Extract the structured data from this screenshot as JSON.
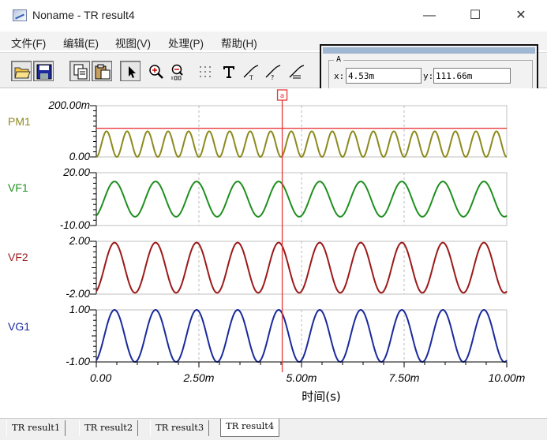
{
  "window": {
    "title": "Noname - TR result4",
    "minimize_glyph": "—",
    "maximize_glyph": "☐",
    "close_glyph": "✕"
  },
  "menu": [
    {
      "label": "文件(F)"
    },
    {
      "label": "编辑(E)"
    },
    {
      "label": "视图(V)"
    },
    {
      "label": "处理(P)"
    },
    {
      "label": "帮助(H)"
    }
  ],
  "toolbar": {
    "icons": [
      "open-folder-icon",
      "save-icon",
      "copy-icon",
      "paste-icon",
      "pointer-icon",
      "zoom-in-icon",
      "zoom-100-icon",
      "grid-icon",
      "text-icon",
      "curve-tool-1-icon",
      "curve-tool-2-icon",
      "curve-tool-3-icon"
    ]
  },
  "cursor_readout": {
    "label": "A",
    "x_label": "x:",
    "x_value": "4.53m",
    "y_label": "y:",
    "y_value": "111.66m"
  },
  "cursor": {
    "label": "a",
    "time": 0.00453,
    "color": "#e8393a"
  },
  "chart_data": {
    "type": "line",
    "xlabel": "时间(s)",
    "xlim": [
      0,
      0.01
    ],
    "x_tick_labels": [
      "0.00",
      "2.50m",
      "5.00m",
      "7.50m",
      "10.00m"
    ],
    "x_ticks": [
      0,
      0.0025,
      0.005,
      0.0075,
      0.01
    ],
    "series": [
      {
        "name": "PM1",
        "color": "#8c8a1e",
        "ylim": [
          0,
          0.2
        ],
        "y_tick_labels": [
          "200.00m",
          "0.00"
        ],
        "offset": 0.05,
        "amplitude": 0.05,
        "periods": 20,
        "reference_line": 0.1117,
        "reference_color": "#e8393a"
      },
      {
        "name": "VF1",
        "color": "#1f8f1f",
        "ylim": [
          -10,
          20
        ],
        "y_tick_labels": [
          "20.00",
          "-10.00"
        ],
        "offset": 5,
        "amplitude": 10,
        "periods": 10
      },
      {
        "name": "VF2",
        "color": "#9b1a1a",
        "ylim": [
          -2,
          2
        ],
        "y_tick_labels": [
          "2.00",
          "-2.00"
        ],
        "offset": 0,
        "amplitude": 1.9,
        "periods": 10
      },
      {
        "name": "VG1",
        "color": "#1a2a9b",
        "ylim": [
          -1,
          1
        ],
        "y_tick_labels": [
          "1.00",
          "-1.00"
        ],
        "offset": 0,
        "amplitude": 1.0,
        "periods": 10
      }
    ]
  },
  "tabs": [
    {
      "label": "TR result1"
    },
    {
      "label": "TR result2"
    },
    {
      "label": "TR result3"
    },
    {
      "label": "TR result4",
      "active": true
    }
  ]
}
